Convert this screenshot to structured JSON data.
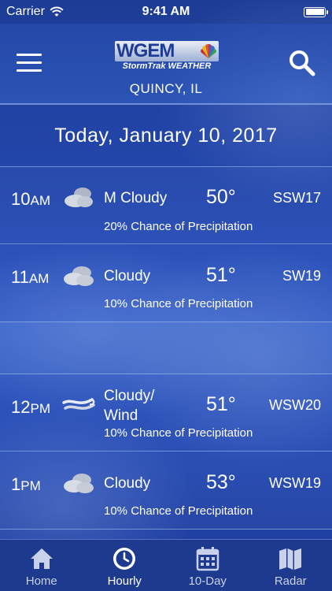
{
  "status_bar": {
    "carrier": "Carrier",
    "time": "9:41 AM"
  },
  "header": {
    "logo_main": "WGEM",
    "logo_sub": "StormTrak WEATHER",
    "location": "QUINCY, IL"
  },
  "date_banner": "Today, January 10, 2017",
  "hourly": [
    {
      "hour": "10",
      "ampm": "AM",
      "icon": "mostly-cloudy-icon",
      "condition": "M Cloudy",
      "temp": "50°",
      "wind": "SSW17",
      "precip": "20% Chance of Precipitation"
    },
    {
      "hour": "11",
      "ampm": "AM",
      "icon": "cloudy-icon",
      "condition": "Cloudy",
      "temp": "51°",
      "wind": "SW19",
      "precip": "10% Chance of Precipitation"
    },
    {
      "hour": "12",
      "ampm": "PM",
      "icon": "wind-icon",
      "condition": "Cloudy/ Wind",
      "temp": "51°",
      "wind": "WSW20",
      "precip": "10% Chance of Precipitation"
    },
    {
      "hour": "1",
      "ampm": "PM",
      "icon": "cloudy-icon",
      "condition": "Cloudy",
      "temp": "53°",
      "wind": "WSW19",
      "precip": "10% Chance of Precipitation"
    }
  ],
  "tabs": [
    {
      "label": "Home",
      "icon": "home-icon",
      "active": false
    },
    {
      "label": "Hourly",
      "icon": "clock-icon",
      "active": true
    },
    {
      "label": "10-Day",
      "icon": "calendar-icon",
      "active": false
    },
    {
      "label": "Radar",
      "icon": "map-icon",
      "active": false
    }
  ]
}
